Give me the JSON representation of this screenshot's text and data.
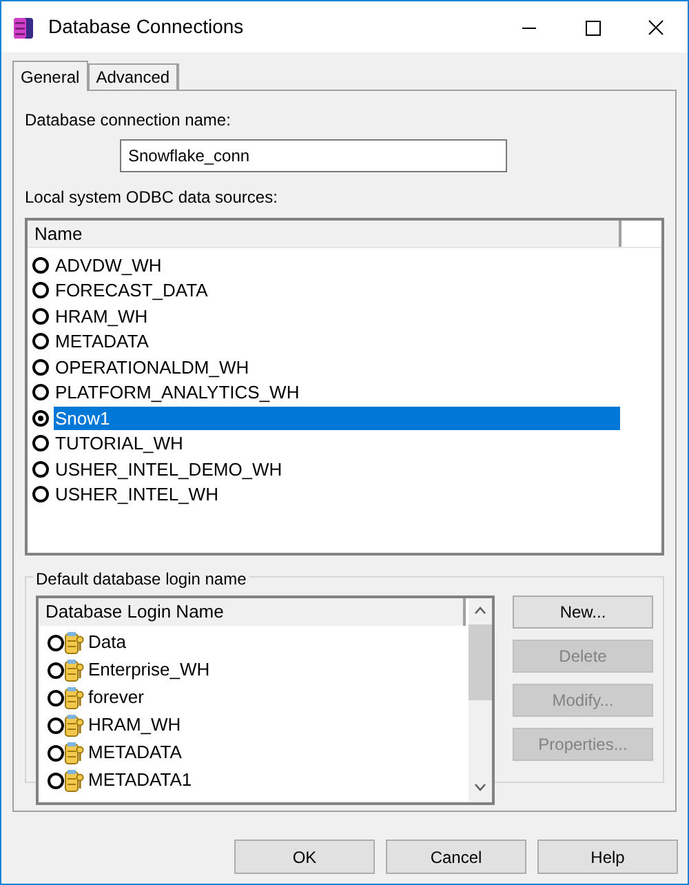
{
  "window": {
    "title": "Database Connections"
  },
  "tabs": [
    {
      "label": "General",
      "selected": true
    },
    {
      "label": "Advanced",
      "selected": false
    }
  ],
  "connection_name": {
    "label": "Database connection name:",
    "value": "Snowflake_conn"
  },
  "data_sources": {
    "label": "Local system ODBC data sources:",
    "column": "Name",
    "items": [
      {
        "name": "ADVDW_WH",
        "selected": false
      },
      {
        "name": "FORECAST_DATA",
        "selected": false
      },
      {
        "name": "HRAM_WH",
        "selected": false
      },
      {
        "name": "METADATA",
        "selected": false
      },
      {
        "name": "OPERATIONALDM_WH",
        "selected": false
      },
      {
        "name": "PLATFORM_ANALYTICS_WH",
        "selected": false
      },
      {
        "name": "Snow1",
        "selected": true
      },
      {
        "name": "TUTORIAL_WH",
        "selected": false
      },
      {
        "name": "USHER_INTEL_DEMO_WH",
        "selected": false
      },
      {
        "name": "USHER_INTEL_WH",
        "selected": false
      }
    ]
  },
  "login_group": {
    "title": "Default database login name",
    "column": "Database Login Name",
    "items": [
      {
        "name": "Data",
        "selected": false
      },
      {
        "name": "Enterprise_WH",
        "selected": false
      },
      {
        "name": "forever",
        "selected": false
      },
      {
        "name": "HRAM_WH",
        "selected": false
      },
      {
        "name": "METADATA",
        "selected": false
      },
      {
        "name": "METADATA1",
        "selected": false
      }
    ],
    "buttons": [
      {
        "label": "New...",
        "disabled": false
      },
      {
        "label": "Delete",
        "disabled": true
      },
      {
        "label": "Modify...",
        "disabled": true
      },
      {
        "label": "Properties...",
        "disabled": true
      }
    ]
  },
  "buttons": [
    "OK",
    "Cancel",
    "Help"
  ]
}
